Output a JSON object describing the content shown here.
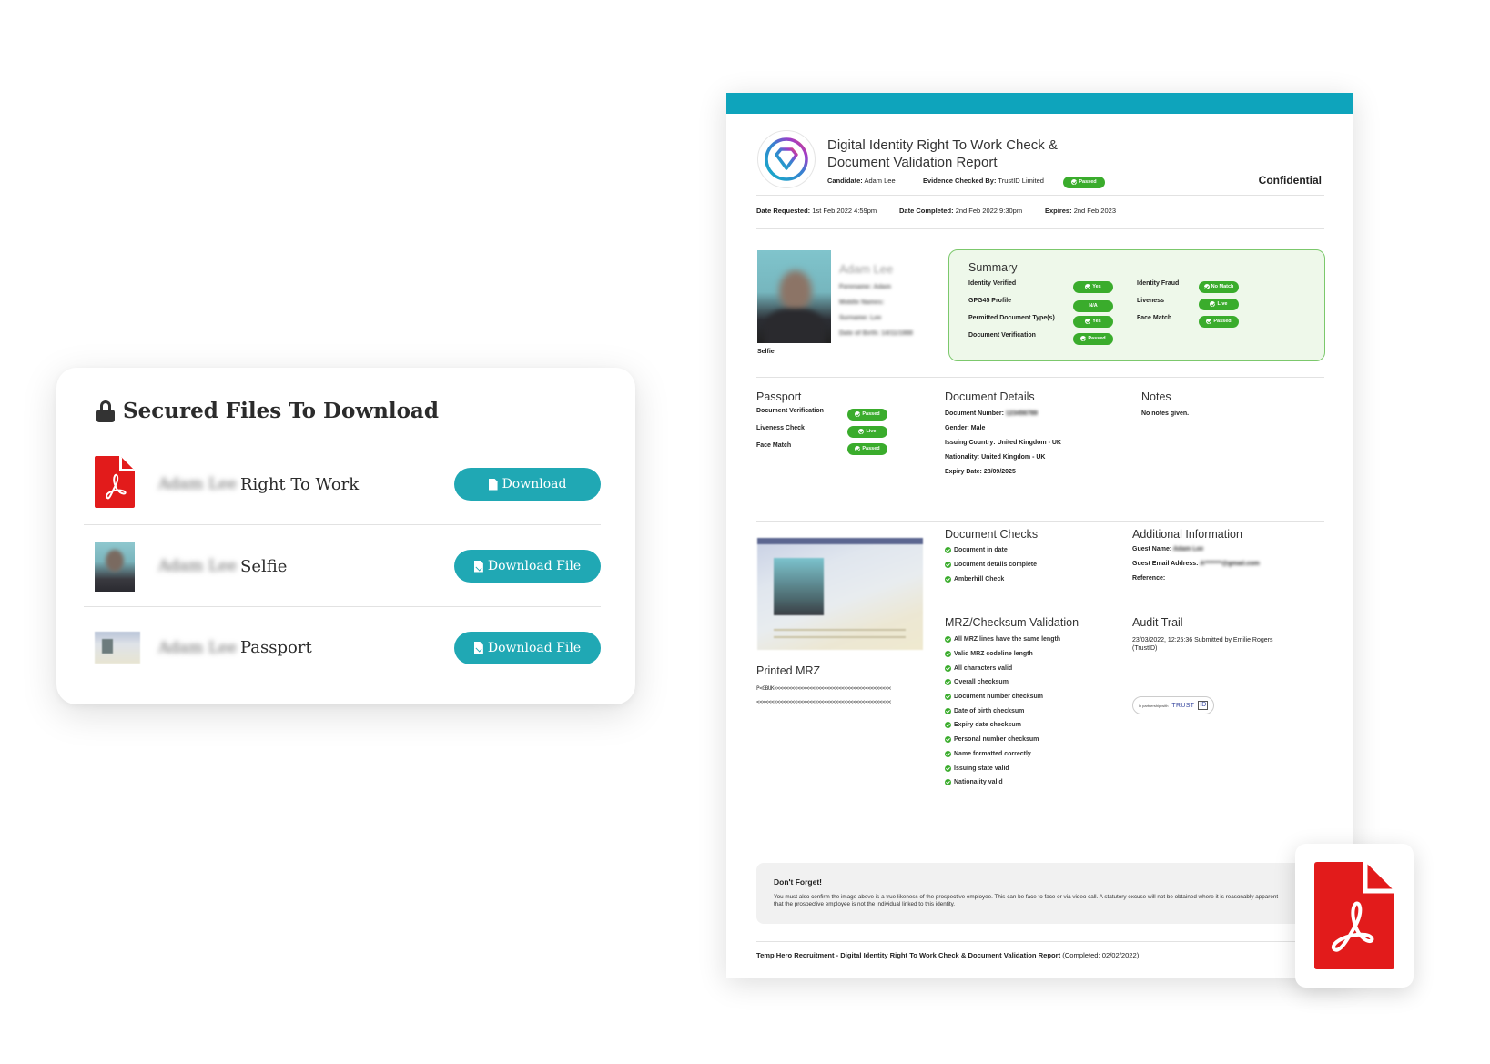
{
  "files_panel": {
    "title": "Secured Files To Download",
    "title_icon": "lock-icon",
    "files": [
      {
        "owner": "Adam Lee",
        "name": "Right To Work",
        "thumb": "pdf-file-icon",
        "button_label": "Download",
        "button_icon": "pdf-file-icon"
      },
      {
        "owner": "Adam Lee",
        "name": "Selfie",
        "thumb": "selfie-thumbnail",
        "button_label": "Download File",
        "button_icon": "file-download-icon"
      },
      {
        "owner": "Adam Lee",
        "name": "Passport",
        "thumb": "passport-thumbnail",
        "button_label": "Download File",
        "button_icon": "file-download-icon"
      }
    ],
    "button_color": "#20a8b4"
  },
  "report": {
    "accent_color": "#0ea4bc",
    "title_line1": "Digital Identity Right To Work Check &",
    "title_line2": "Document Validation Report",
    "candidate_label": "Candidate:",
    "candidate_value": "Adam Lee",
    "checked_by_label": "Evidence Checked By:",
    "checked_by_value": "TrustID Limited",
    "overall_status": "Passed",
    "confidential": "Confidential",
    "date_requested_label": "Date Requested:",
    "date_requested": "1st Feb 2022 4:59pm",
    "date_completed_label": "Date Completed:",
    "date_completed": "2nd Feb 2022 9:30pm",
    "expires_label": "Expires:",
    "expires": "2nd Feb 2023",
    "person": {
      "name": "Adam Lee",
      "forename": "Forename: Adam",
      "middle_names": "Middle Names:",
      "surname": "Surname: Lee",
      "dob": "Date of Birth: 14/11/1988",
      "selfie_label": "Selfie"
    },
    "summary": {
      "heading": "Summary",
      "left": [
        {
          "label": "Identity Verified",
          "status": "Yes",
          "tick": true
        },
        {
          "label": "GPG45 Profile",
          "status": "N/A",
          "tick": false
        },
        {
          "label": "Permitted Document Type(s)",
          "status": "Yes",
          "tick": true
        },
        {
          "label": "Document Verification",
          "status": "Passed",
          "tick": true
        }
      ],
      "right": [
        {
          "label": "Identity Fraud",
          "status": "No Match",
          "tick": true
        },
        {
          "label": "Liveness",
          "status": "Live",
          "tick": true
        },
        {
          "label": "Face Match",
          "status": "Passed",
          "tick": true
        }
      ]
    },
    "passport": {
      "heading": "Passport",
      "items": [
        {
          "label": "Document Verification",
          "status": "Passed"
        },
        {
          "label": "Liveness Check",
          "status": "Live"
        },
        {
          "label": "Face Match",
          "status": "Passed"
        }
      ]
    },
    "document_details": {
      "heading": "Document Details",
      "document_number_label": "Document Number:",
      "document_number": "123456789",
      "gender_label": "Gender:",
      "gender": "Male",
      "issuing_country_label": "Issuing Country:",
      "issuing_country": "United Kingdom - UK",
      "nationality_label": "Nationality:",
      "nationality": "United Kingdom - UK",
      "expiry_label": "Expiry Date:",
      "expiry": "28/09/2025"
    },
    "notes": {
      "heading": "Notes",
      "text": "No notes given."
    },
    "printed_mrz": {
      "heading": "Printed MRZ",
      "line1": "P<GBUK<<<<<<<<<<<<<<<<<<<<<<<<<<<<<<<<<<<<<<<<",
      "line2": "<<<<<<<<<<<<<<<<<<<<<<<<<<<<<<<<<<<<<<<<<<<<<<"
    },
    "document_checks": {
      "heading": "Document Checks",
      "items": [
        "Document in date",
        "Document details complete",
        "Amberhill Check"
      ]
    },
    "additional_info": {
      "heading": "Additional Information",
      "guest_name_label": "Guest Name:",
      "guest_name": "Adam Lee",
      "guest_email_label": "Guest Email Address:",
      "guest_email": "A*******@gmail.com",
      "reference_label": "Reference:"
    },
    "mrz_validation": {
      "heading": "MRZ/Checksum Validation",
      "items": [
        "All MRZ lines have the same length",
        "Valid MRZ codeline length",
        "All characters valid",
        "Overall checksum",
        "Document number checksum",
        "Date of birth checksum",
        "Expiry date checksum",
        "Personal number checksum",
        "Name formatted correctly",
        "Issuing state valid",
        "Nationality valid"
      ]
    },
    "audit_trail": {
      "heading": "Audit Trail",
      "entry": "23/03/2022, 12:25:36 Submitted by Emilie Rogers (TrustID)",
      "partner_text": "In partnership with",
      "partner_brand": "TRUST",
      "partner_brand_id": "ID"
    },
    "dont_forget": {
      "title": "Don't Forget!",
      "body": "You must also confirm the image above is a true likeness of the prospective employee. This can be face to face or via video call. A statutory excuse will not be obtained where it is reasonably apparent that the prospective employee is not the individual linked to this identity."
    },
    "footer": {
      "title": "Temp Hero Recruitment - Digital Identity Right To Work Check & Document Validation Report",
      "completed": "(Completed: 02/02/2022)"
    },
    "status_color": "#3aac2c"
  },
  "pdf_tile": {
    "icon": "pdf-file-icon",
    "color": "#e21b1b"
  }
}
